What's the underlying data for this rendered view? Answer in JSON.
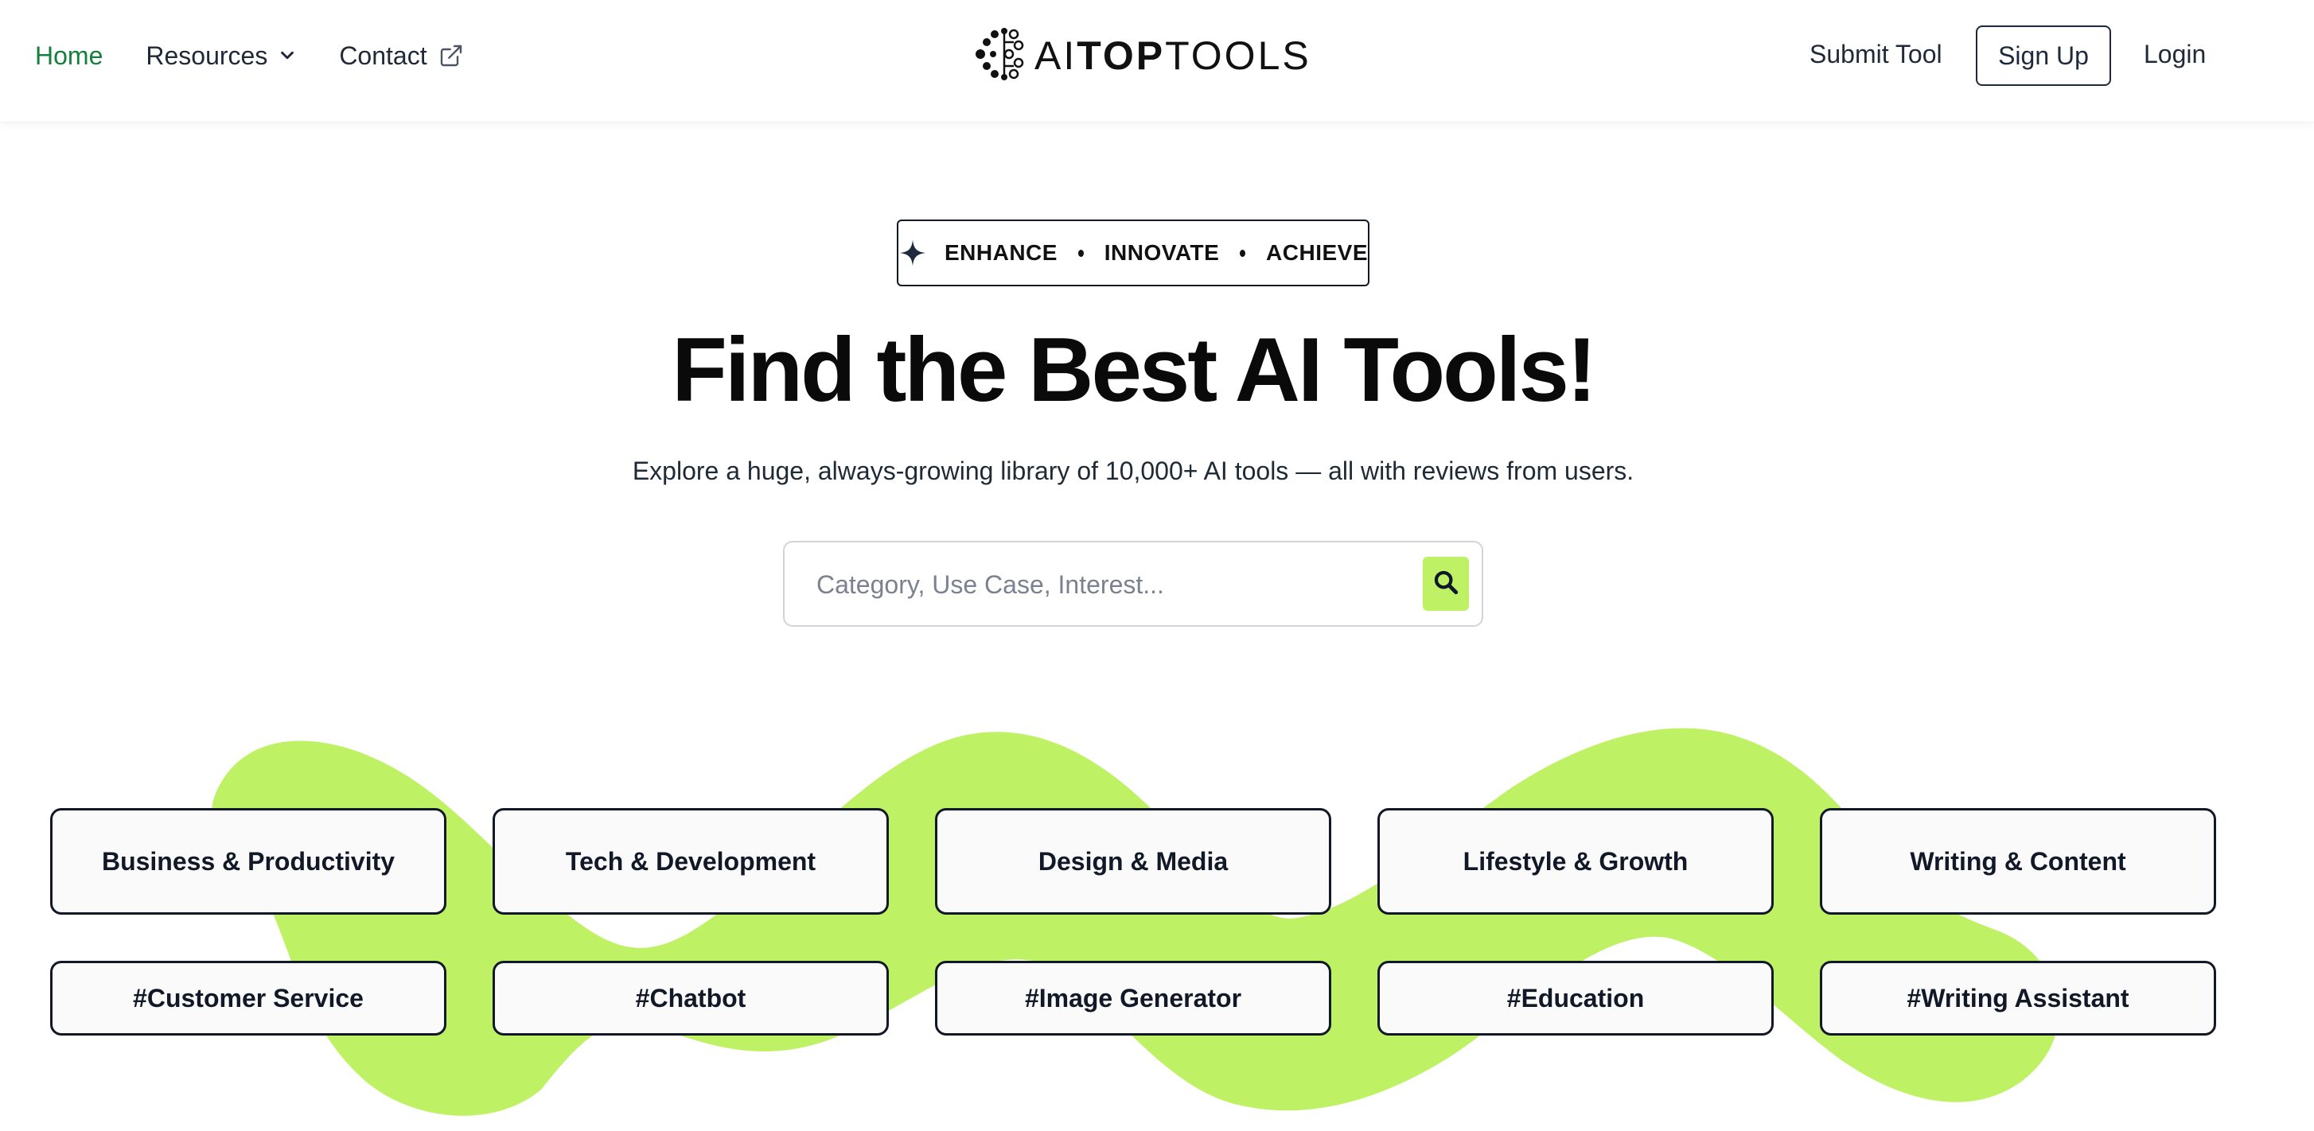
{
  "header": {
    "nav": {
      "home": "Home",
      "resources": "Resources",
      "contact": "Contact"
    },
    "logo": {
      "part1": "AI",
      "part2": "TOP",
      "part3": "TOOLS"
    },
    "submit_tool": "Submit Tool",
    "sign_up": "Sign Up",
    "login": "Login"
  },
  "hero": {
    "tagline": [
      "ENHANCE",
      "INNOVATE",
      "ACHIEVE"
    ],
    "title": "Find the Best AI Tools!",
    "subtitle": "Explore a huge, always-growing library of 10,000+ AI tools — all with reviews from users.",
    "search_placeholder": "Category, Use Case, Interest..."
  },
  "categories": [
    "Business & Productivity",
    "Tech & Development",
    "Design & Media",
    "Lifestyle & Growth",
    "Writing & Content"
  ],
  "tags": [
    "#Customer Service",
    "#Chatbot",
    "#Image Generator",
    "#Education",
    "#Writing Assistant"
  ],
  "colors": {
    "accent_green": "#bef264",
    "active_nav": "#15803d",
    "border_dark": "#111827"
  },
  "icons": {
    "resources": "chevron-down-icon",
    "contact": "external-link-icon",
    "tagline": "sparkle-icon",
    "search": "search-icon",
    "logo": "brain-network-icon"
  }
}
